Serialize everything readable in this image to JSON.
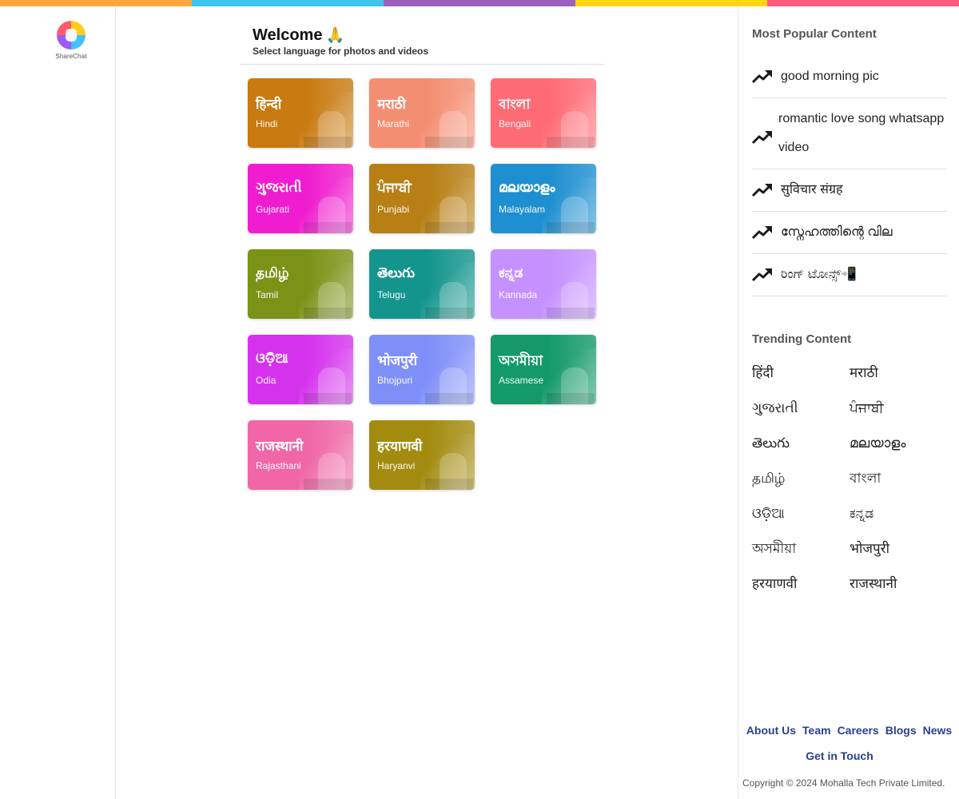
{
  "topbar_colors": [
    "#ffa63f",
    "#3fc4f2",
    "#9b5fc0",
    "#ffd614",
    "#ff5b7e"
  ],
  "logo": {
    "text": "ShareChat"
  },
  "welcome": {
    "title": "Welcome",
    "emoji": "🙏",
    "subtitle": "Select language for photos and videos"
  },
  "languages": [
    {
      "native": "हिन्दी",
      "english": "Hindi",
      "color": "#c97a10"
    },
    {
      "native": "मराठी",
      "english": "Marathi",
      "color": "#f48e72"
    },
    {
      "native": "বাংলা",
      "english": "Bengali",
      "color": "#ff6b74"
    },
    {
      "native": "ગુજરાતી",
      "english": "Gujarati",
      "color": "#f01ccf"
    },
    {
      "native": "ਪੰਜਾਬੀ",
      "english": "Punjabi",
      "color": "#b77f14"
    },
    {
      "native": "മലയാളം",
      "english": "Malayalam",
      "color": "#1e8fd0"
    },
    {
      "native": "தமிழ்",
      "english": "Tamil",
      "color": "#7a9216"
    },
    {
      "native": "తెలుగు",
      "english": "Telugu",
      "color": "#13958d"
    },
    {
      "native": "ಕನ್ನಡ",
      "english": "Kannada",
      "color": "#c591ff"
    },
    {
      "native": "ଓଡ଼ିଆ",
      "english": "Odia",
      "color": "#d532ee"
    },
    {
      "native": "भोजपुरी",
      "english": "Bhojpuri",
      "color": "#7f8ff8"
    },
    {
      "native": "অসমীয়া",
      "english": "Assamese",
      "color": "#149a68"
    },
    {
      "native": "राजस्थानी",
      "english": "Rajasthani",
      "color": "#f066a6"
    },
    {
      "native": "हरयाणवी",
      "english": "Haryanvi",
      "color": "#a38b10"
    }
  ],
  "popular": {
    "title": "Most Popular Content",
    "items": [
      "good morning pic",
      "romantic love song whatsapp video",
      "सुविचार संग्रह",
      "സ്നേഹത്തിന്റെ വില",
      "ರಿಂಗ್ ಟೋನ್ಸ್📲"
    ]
  },
  "trending": {
    "title": "Trending Content",
    "items": [
      "हिंदी",
      "मराठी",
      "ગુજરાતી",
      "ਪੰਜਾਬੀ",
      "తెలుగు",
      "മലയാളം",
      "தமிழ்",
      "বাংলা",
      "ଓଡ଼ିଆ",
      "ಕನ್ನಡ",
      "অসমীয়া",
      "भोजपुरी",
      "हरयाणवी",
      "राजस्थानी"
    ]
  },
  "footer": {
    "links": [
      "About Us",
      "Team",
      "Careers",
      "Blogs",
      "News"
    ],
    "touch": "Get in Touch",
    "copyright": "Copyright © 2024 Mohalla Tech Private Limited."
  },
  "icons": {
    "logo": "sharechat-logo",
    "trend": "trending-up-icon"
  }
}
